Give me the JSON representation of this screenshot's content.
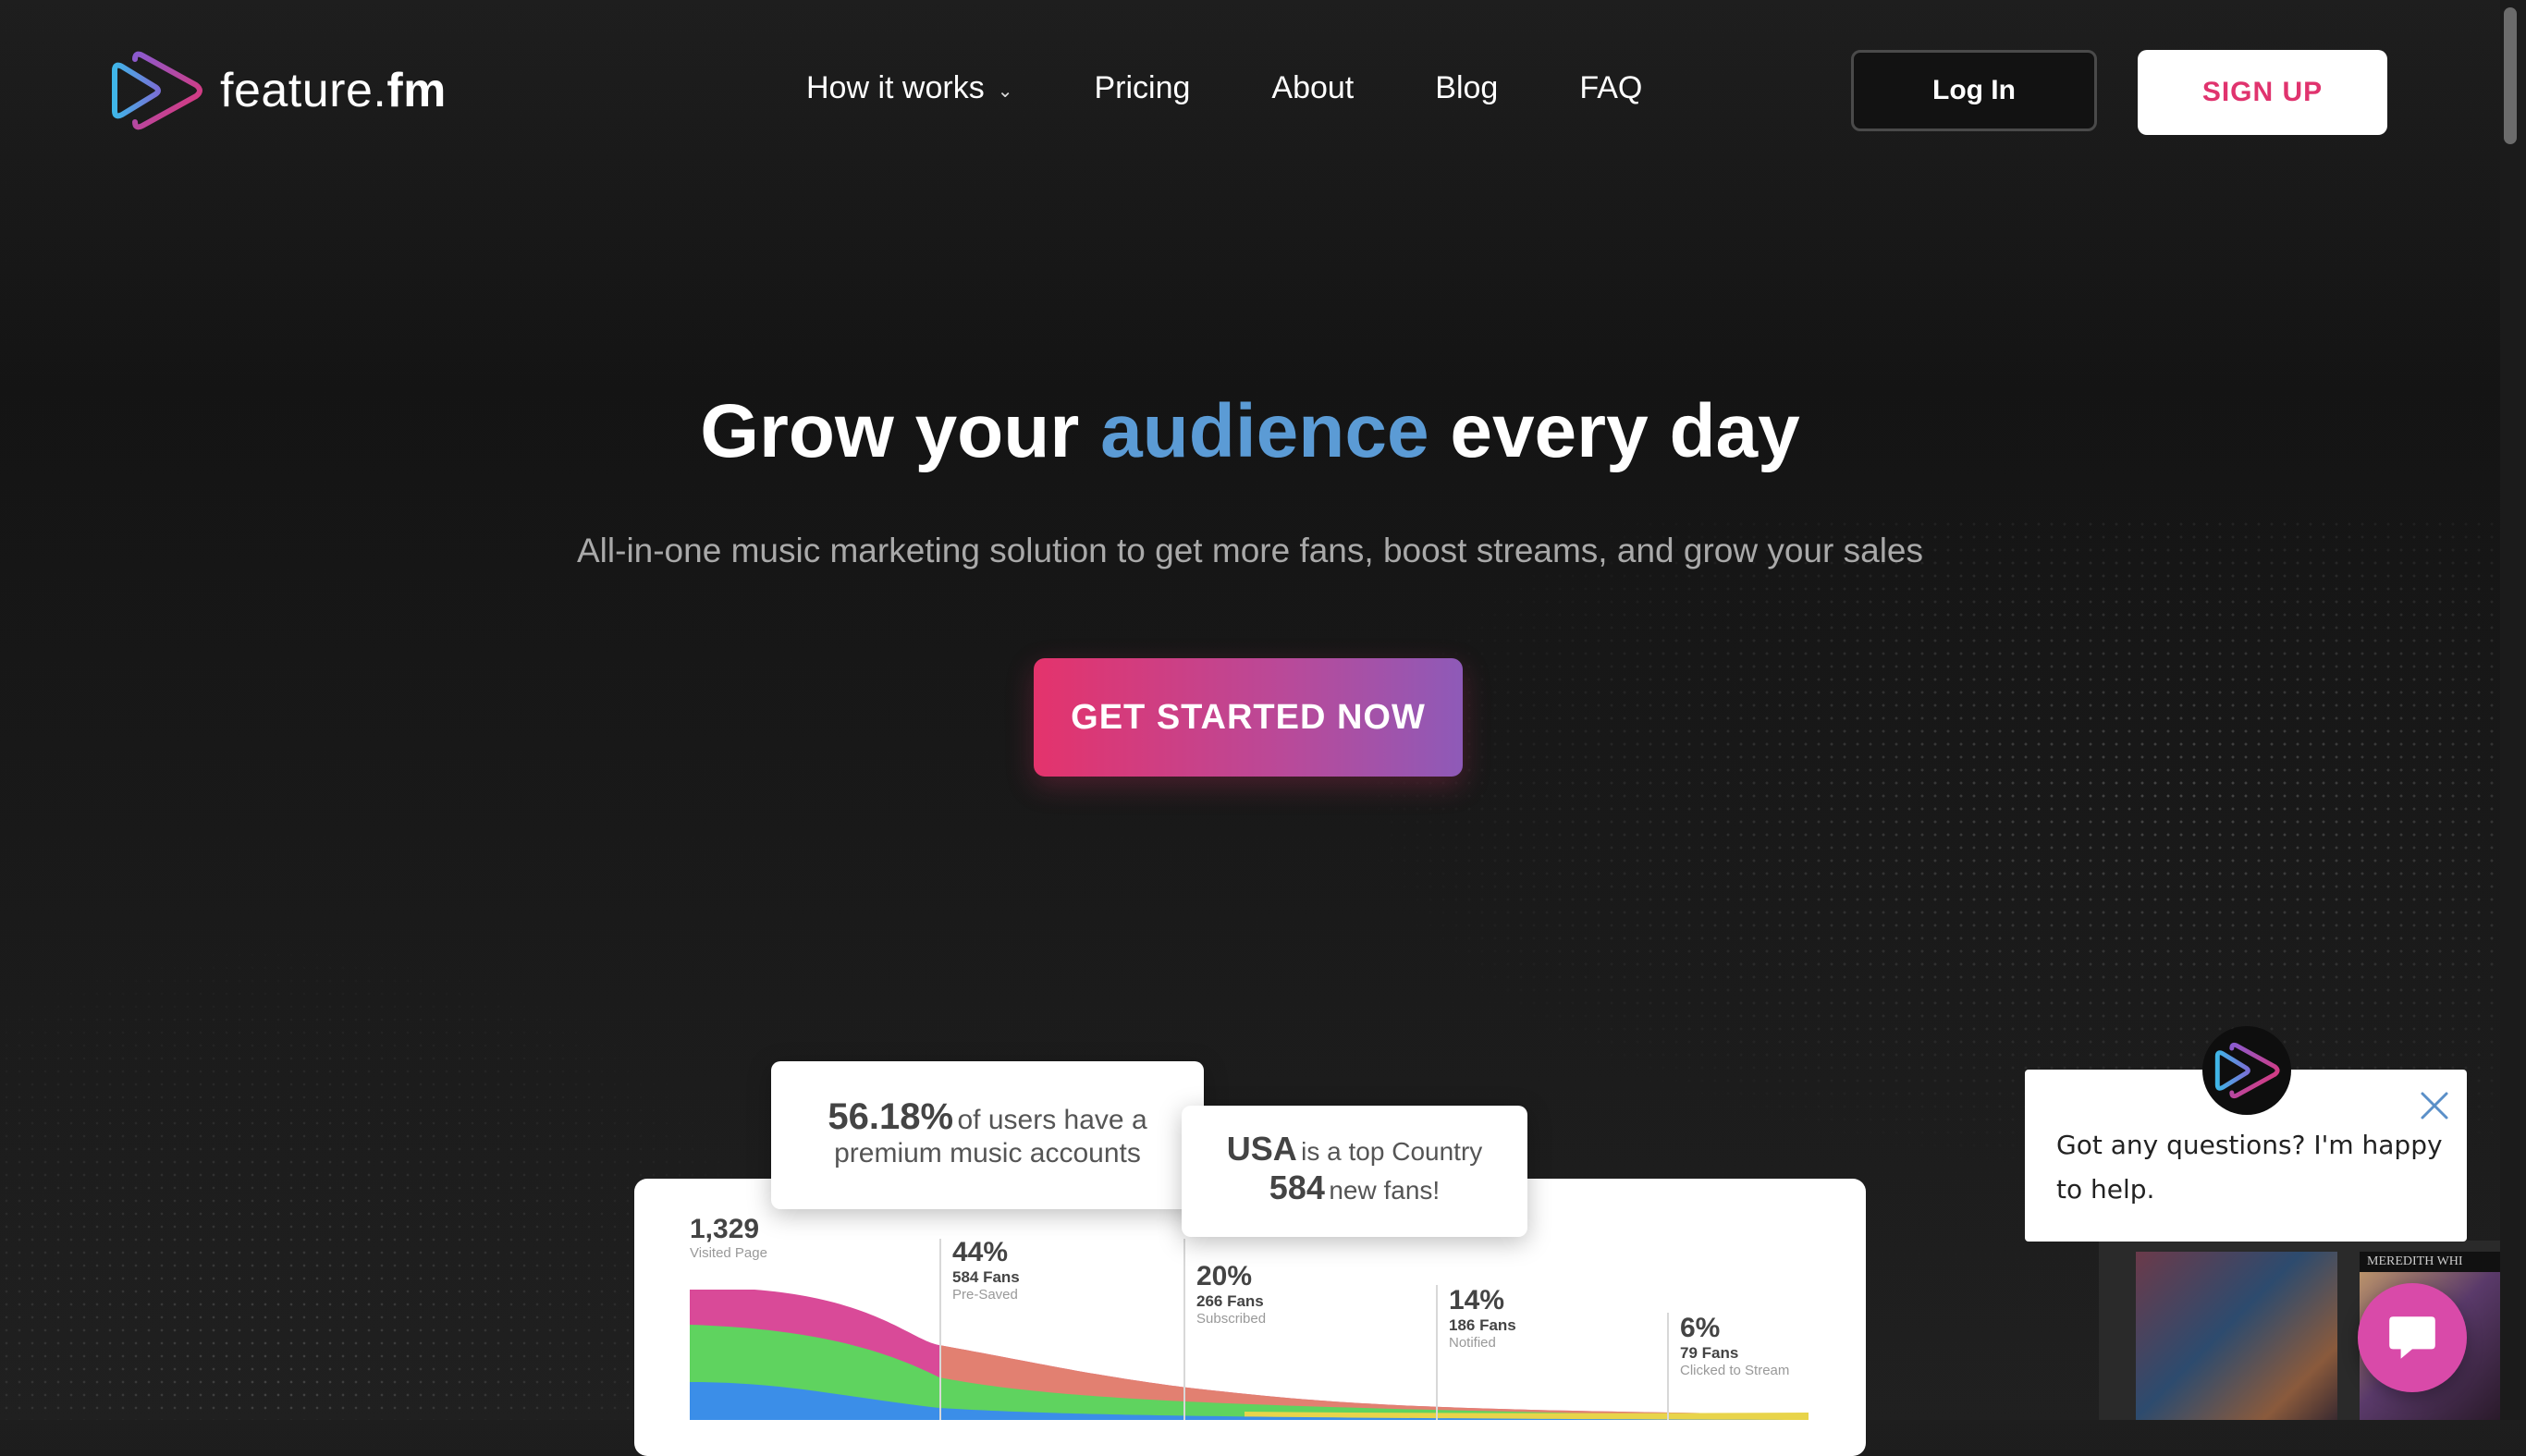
{
  "brand": {
    "name_light": "feature.",
    "name_bold": "fm"
  },
  "nav": {
    "items": [
      {
        "label": "How it works",
        "has_dropdown": true
      },
      {
        "label": "Pricing"
      },
      {
        "label": "About"
      },
      {
        "label": "Blog"
      },
      {
        "label": "FAQ"
      }
    ],
    "login_label": "Log In",
    "signup_label": "SIGN UP"
  },
  "hero": {
    "title_before": "Grow your",
    "title_accent": "audience",
    "title_after": "every day",
    "subtitle": "All-in-one music marketing solution to get more fans, boost streams, and grow your sales",
    "cta_label": "GET STARTED NOW"
  },
  "dashboard": {
    "card_premium": {
      "value": "56.18%",
      "text_line1": "of users have a",
      "text_line2": "premium music accounts"
    },
    "card_country": {
      "country": "USA",
      "text_line1": "is a top Country",
      "value": "584",
      "text_line2": "new fans!"
    },
    "funnel_stages": [
      {
        "value": "1,329",
        "fans": "",
        "label": "Visited Page"
      },
      {
        "value": "44%",
        "fans": "584 Fans",
        "label": "Pre-Saved"
      },
      {
        "value": "20%",
        "fans": "266 Fans",
        "label": "Subscribed"
      },
      {
        "value": "14%",
        "fans": "186 Fans",
        "label": "Notified"
      },
      {
        "value": "6%",
        "fans": "79 Fans",
        "label": "Clicked to Stream"
      }
    ]
  },
  "chat": {
    "message": "Got any questions? I'm happy to help.",
    "album_caption": "MEREDITH WHI"
  },
  "colors": {
    "accent_blue": "#5b9bd5",
    "brand_pink": "#e4336c",
    "brand_purple": "#8e5ab8",
    "chat_pink": "#d94aa9"
  }
}
